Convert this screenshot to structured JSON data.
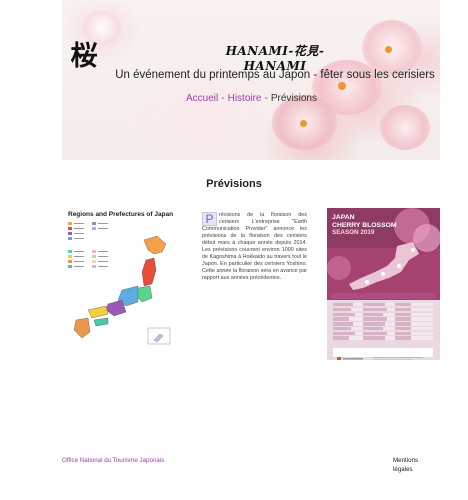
{
  "header": {
    "logo_glyph": "桜",
    "site_title": "HANAMI-花見-HANAMI",
    "subtitle": "Un événement du printemps au Japon - fêter sous les cerisiers"
  },
  "nav": {
    "items": [
      {
        "label": "Accueil"
      },
      {
        "label": "Histoire"
      },
      {
        "label": "Prévisions"
      }
    ],
    "separator": "-"
  },
  "page_title": "Prévisions",
  "map": {
    "title": "Regions and Prefectures of Japan"
  },
  "article": {
    "dropcap": "P",
    "text": "révisions de la floraison des cerisiers L'entreprise \"Earth Communication Provider\" annonce les prévisions de la floraison des cerisiers début mars à chaque année depuis 2014. Les prévisions couvrent environ 1000 sites de Kagoshima à Hokkaido au travers tout le Japon. En particulier des cerisiers Yoshino. Cette année la floraison sera en avance par rapport aux années précédentes."
  },
  "poster": {
    "title_line1": "JAPAN",
    "title_line2": "CHERRY BLOSSOM",
    "season": "SEASON 2019"
  },
  "footer": {
    "left": "Office National du Tourisme Japonais",
    "right": "Mentions légales"
  },
  "colors": {
    "link": "#9b3fae",
    "banner_bg": "#f6eeec",
    "poster_bg": "#ead9e2",
    "poster_sky": "#a5426f"
  }
}
